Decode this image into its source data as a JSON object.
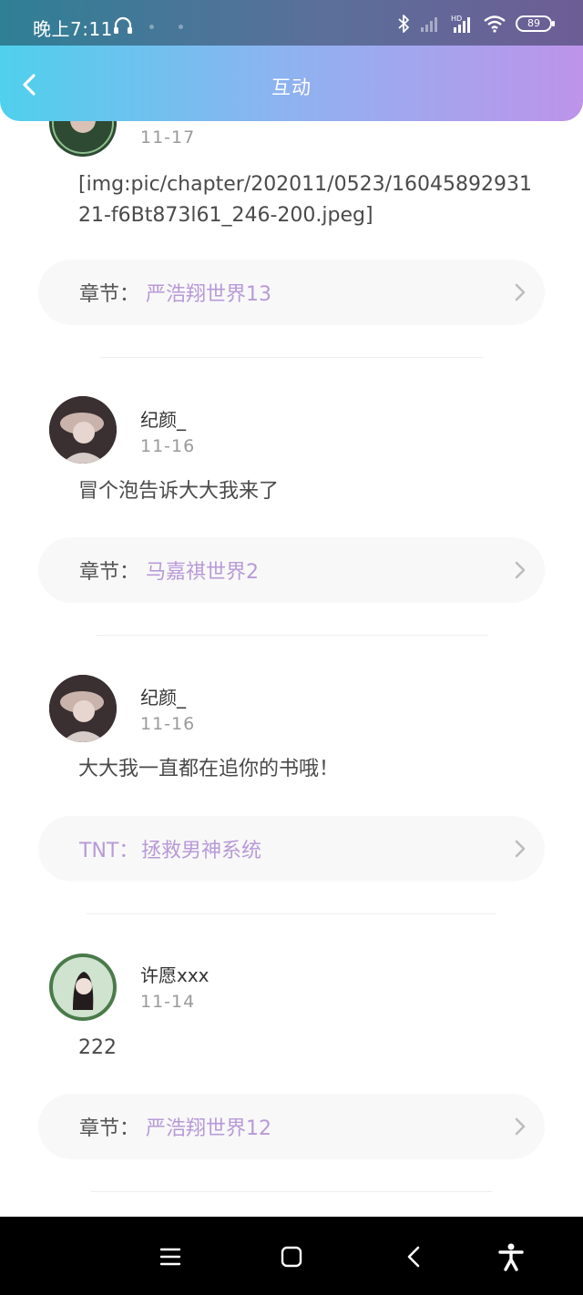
{
  "status_bar": {
    "time": "晚上7:11",
    "battery": "89",
    "icons": [
      "headset-icon",
      "bluetooth-icon",
      "signal-icon",
      "hd-signal-icon",
      "wifi-icon",
      "battery-icon"
    ]
  },
  "header": {
    "title": "互动",
    "back_icon": "chevron-left-icon"
  },
  "colors": {
    "gradient_start": "#4fd0ec",
    "gradient_end": "#bd94ea",
    "chapter_accent": "#b89ad8"
  },
  "posts": [
    {
      "date": "11-17",
      "content": "[img:pic/chapter/202011/0523/1604589293121-f6Bt873l61_246-200.jpeg]",
      "chapter_label": "章节：",
      "chapter_name": "严浩翔世界13"
    },
    {
      "username": "纪颜_",
      "date": "11-16",
      "content": "冒个泡告诉大大我来了",
      "chapter_label": "章节：",
      "chapter_name": "马嘉祺世界2"
    },
    {
      "username": "纪颜_",
      "date": "11-16",
      "content": "大大我一直都在追你的书哦！",
      "chapter_label": "TNT：",
      "chapter_name": "拯救男神系统"
    },
    {
      "username": "许愿xxx",
      "date": "11-14",
      "content": "222",
      "chapter_label": "章节：",
      "chapter_name": "严浩翔世界12"
    }
  ],
  "nav_bar": {
    "items": [
      "menu-icon",
      "home-icon",
      "back-icon",
      "accessibility-icon"
    ]
  }
}
